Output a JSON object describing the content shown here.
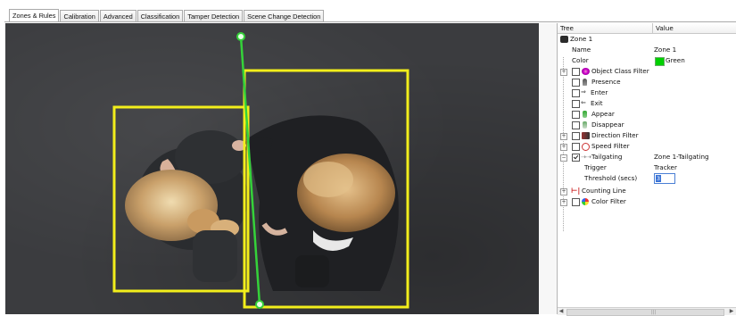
{
  "tabs": [
    {
      "label": "Zones & Rules",
      "active": true
    },
    {
      "label": "Calibration",
      "active": false
    },
    {
      "label": "Advanced",
      "active": false
    },
    {
      "label": "Classification",
      "active": false
    },
    {
      "label": "Tamper Detection",
      "active": false
    },
    {
      "label": "Scene Change Detection",
      "active": false
    }
  ],
  "panel": {
    "col_tree": "Tree",
    "col_value": "Value",
    "rows": {
      "zone": {
        "label": "Zone 1"
      },
      "name": {
        "label": "Name",
        "value": "Zone 1"
      },
      "color": {
        "label": "Color",
        "value": "Green",
        "swatch": "#00d000"
      },
      "object_class_filter": {
        "label": "Object Class Filter",
        "icon": "object-class-icon"
      },
      "presence": {
        "label": "Presence",
        "icon": "person-icon"
      },
      "enter": {
        "label": "Enter",
        "icon": "enter-arrow-icon"
      },
      "exit": {
        "label": "Exit",
        "icon": "exit-arrow-icon"
      },
      "appear": {
        "label": "Appear",
        "icon": "appear-icon"
      },
      "disappear": {
        "label": "Disappear",
        "icon": "disappear-icon"
      },
      "direction_filter": {
        "label": "Direction Filter",
        "icon": "direction-icon"
      },
      "speed_filter": {
        "label": "Speed Filter",
        "icon": "speed-icon"
      },
      "tailgating": {
        "label": "Tailgating",
        "value": "Zone 1-Tailgating",
        "checked": true,
        "icon": "tailgating-icon"
      },
      "trigger": {
        "label": "Trigger",
        "value": "Tracker"
      },
      "threshold": {
        "label": "Threshold (secs)",
        "value": "3"
      },
      "counting_line": {
        "label": "Counting Line",
        "icon": "counting-line-icon"
      },
      "color_filter": {
        "label": "Color Filter",
        "icon": "color-wheel-icon"
      }
    }
  },
  "colors": {
    "zone_box": "#f2ee1b",
    "tripwire": "#35d23a",
    "video_bg": "#3b3c3f"
  }
}
